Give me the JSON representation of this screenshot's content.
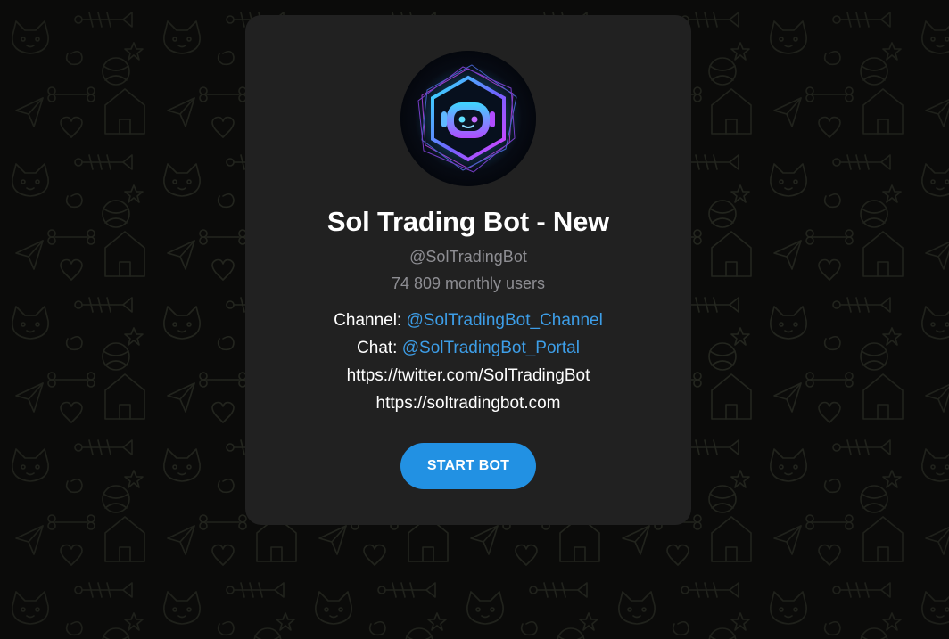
{
  "bot": {
    "title": "Sol Trading Bot - New",
    "username": "@SolTradingBot",
    "monthly_users": "74 809 monthly users"
  },
  "description": {
    "channel_label": "Channel: ",
    "channel_link": "@SolTradingBot_Channel",
    "chat_label": "Chat: ",
    "chat_link": "@SolTradingBot_Portal",
    "twitter": "https://twitter.com/SolTradingBot",
    "website": "https://soltradingbot.com"
  },
  "actions": {
    "start_label": "START BOT"
  },
  "icons": {
    "avatar": "robot-hexagon-logo"
  },
  "colors": {
    "background": "#0b0b0a",
    "card": "#212121",
    "link": "#3d9ee8",
    "button": "#2291e3",
    "muted_text": "#8e8e93"
  }
}
